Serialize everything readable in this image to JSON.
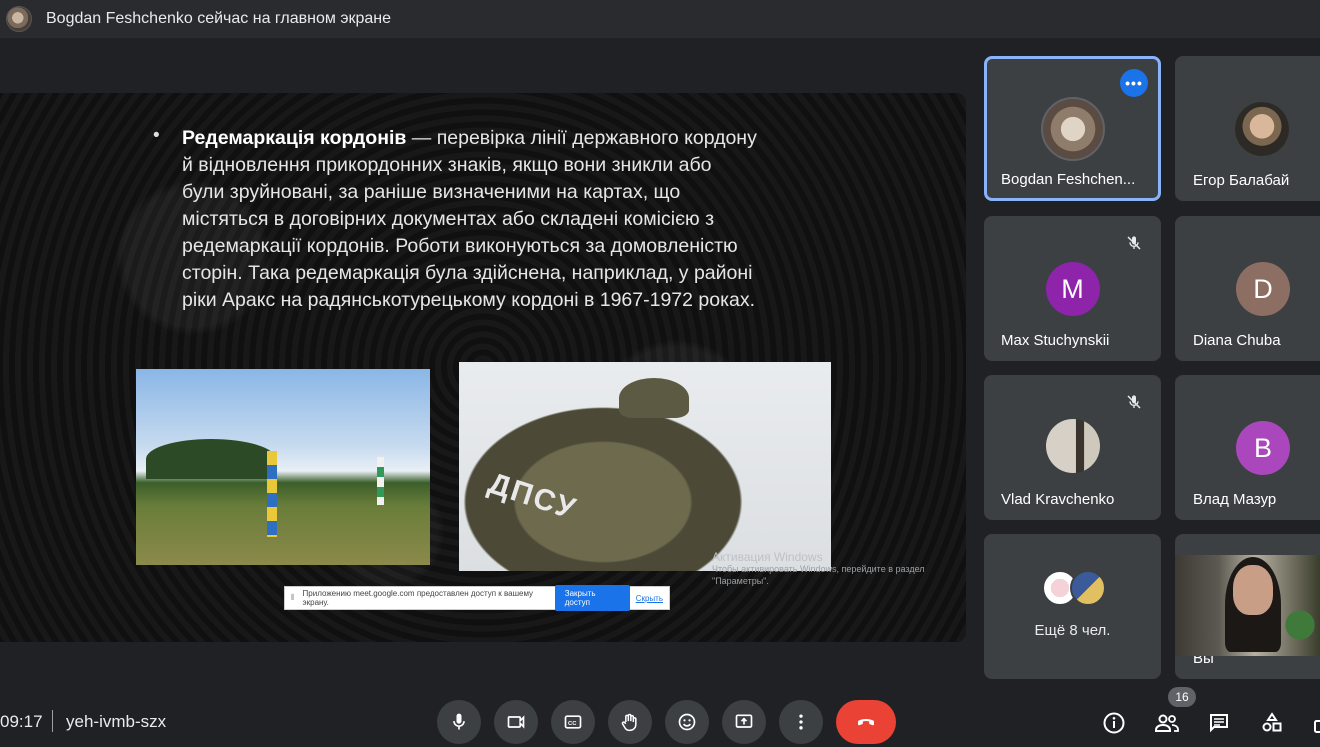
{
  "header": {
    "presenter_notice": "Bogdan Feshchenko сейчас на главном экране"
  },
  "slide": {
    "term": "Редемаркація кордонів",
    "lines": [
      "— перевірка лінії державного кордону",
      "й відновлення прикордонних знаків, якщо вони зникли або",
      "були зруйновані, за раніше визначеними на картах, що",
      "містяться в договірних документах або складені комісією з",
      "редемаркації кордонів. Роботи виконуються за домовленістю",
      "сторін. Така редемаркація була здійснена, наприклад, у районі",
      "ріки Аракс на радянськотурецькому кордоні в 1967-1972 роках."
    ],
    "photo_text": "ДПСУ",
    "share_bar": {
      "message": "Приложению meet.google.com предоставлен доступ к вашему экрану.",
      "stop_label": "Закрыть доступ",
      "hide_label": "Скрыть"
    },
    "windows_watermark": {
      "title": "Активация Windows",
      "line1": "Чтобы активировать Windows, перейдите в раздел",
      "line2": "\"Параметры\"."
    }
  },
  "participants": [
    {
      "name": "Bogdan Feshchen...",
      "type": "photo",
      "muted": false,
      "active": true
    },
    {
      "name": "Егор Балабай",
      "type": "photo",
      "muted": false
    },
    {
      "name": "Max Stuchynskii",
      "letter": "M",
      "color": "#8e24aa",
      "muted": true
    },
    {
      "name": "Diana Chuba",
      "letter": "D",
      "color": "#8d6e63",
      "muted": false
    },
    {
      "name": "Vlad Kravchenko",
      "type": "photo",
      "muted": true
    },
    {
      "name": "Влад Мазур",
      "letter": "B",
      "color": "#ab47bc",
      "muted": false
    }
  ],
  "more_tile": {
    "label": "Ещё 8 чел."
  },
  "self_tile": {
    "label": "Вы"
  },
  "footer": {
    "time": "09:17",
    "meeting_code": "yeh-ivmb-szx",
    "people_count": "16"
  }
}
